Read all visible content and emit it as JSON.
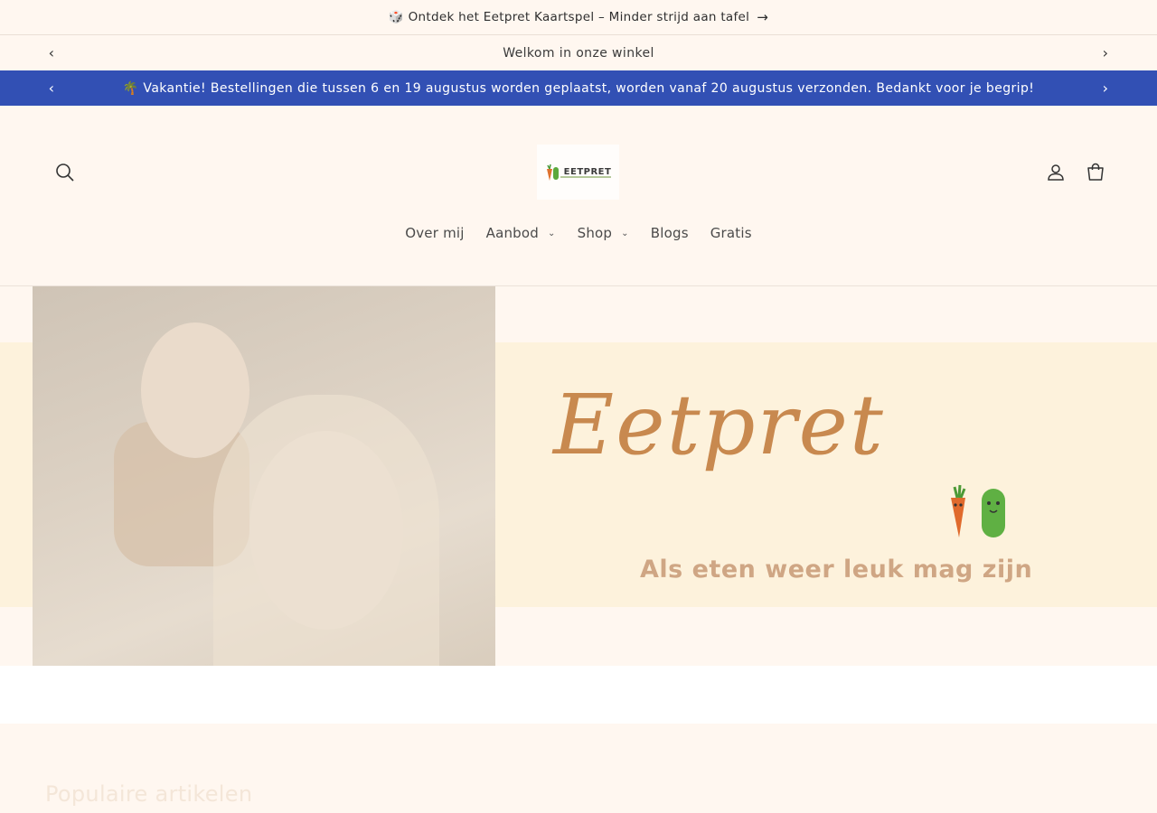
{
  "announcement": {
    "icon": "game-die-icon",
    "text": "🎲 Ontdek het Eetpret Kaartspel – Minder strijd aan tafel"
  },
  "welcome_bar": {
    "text": "Welkom in onze winkel"
  },
  "vacation_bar": {
    "text": "🌴 Vakantie! Bestellingen die tussen 6 en 19 augustus worden geplaatst, worden vanaf 20 augustus verzonden. Bedankt voor je begrip!",
    "color": "#3250b4"
  },
  "header": {
    "logo_text": "EETPRET"
  },
  "nav": {
    "items": [
      {
        "label": "Over mij",
        "has_dropdown": false
      },
      {
        "label": "Aanbod",
        "has_dropdown": true
      },
      {
        "label": "Shop",
        "has_dropdown": true
      },
      {
        "label": "Blogs",
        "has_dropdown": false
      },
      {
        "label": "Gratis",
        "has_dropdown": false
      }
    ]
  },
  "hero": {
    "brand": "Eetpret",
    "tagline": "Als eten weer leuk mag zijn"
  },
  "section": {
    "title": "Populaire artikelen"
  },
  "colors": {
    "background": "#fff7f0",
    "accent": "#3250b4",
    "brand_brown": "#c8894f"
  }
}
